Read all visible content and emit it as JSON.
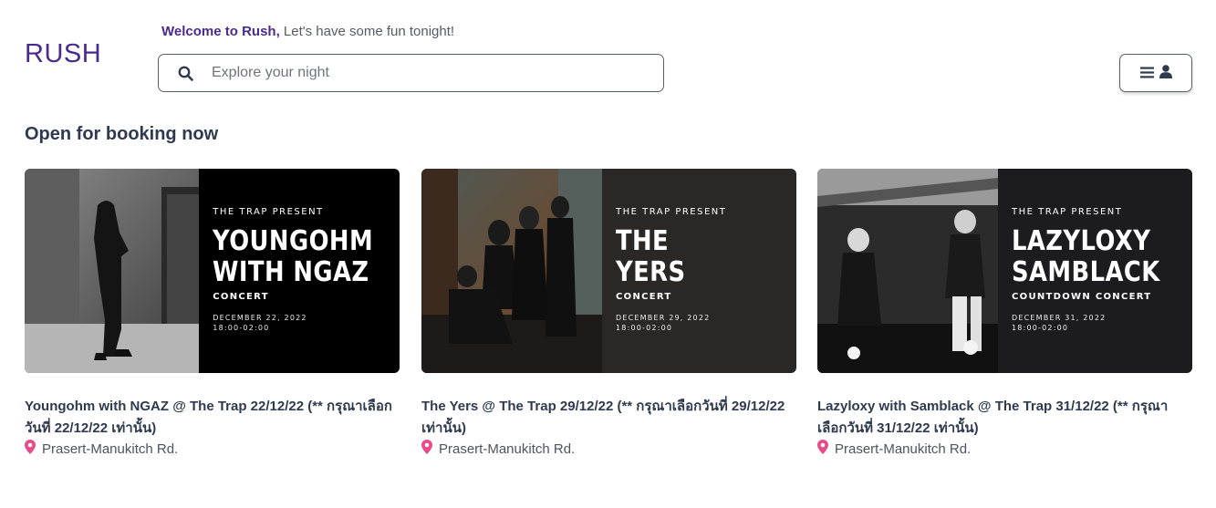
{
  "header": {
    "logo": "RUSH",
    "welcome_brand": "Welcome to Rush,",
    "welcome_text": " Let's have some fun tonight!",
    "search_placeholder": "Explore your night"
  },
  "section": {
    "title": "Open for booking now"
  },
  "events": [
    {
      "present": "THE TRAP PRESENT",
      "name_line1": "YOUNGOHM",
      "name_line2": "WITH NGAZ",
      "kind": "CONCERT",
      "date": "DECEMBER 22, 2022",
      "time": "18:00-02:00",
      "title": "Youngohm with NGAZ @ The Trap 22/12/22 (** กรุณาเลือกวันที่ 22/12/22 เท่านั้น)",
      "location": "Prasert-Manukitch Rd.",
      "panel_color": "#000000"
    },
    {
      "present": "THE TRAP PRESENT",
      "name_line1": "THE",
      "name_line2": "YERS",
      "kind": "CONCERT",
      "date": "DECEMBER 29, 2022",
      "time": "18:00-02:00",
      "title": "The Yers @ The Trap 29/12/22 (** กรุณาเลือกวันที่ 29/12/22 เท่านั้น)",
      "location": "Prasert-Manukitch Rd.",
      "panel_color": "#2a2724"
    },
    {
      "present": "THE TRAP PRESENT",
      "name_line1": "LAZYLOXY",
      "name_line2": "SAMBLACK",
      "kind": "COUNTDOWN CONCERT",
      "date": "DECEMBER 31, 2022",
      "time": "18:00-02:00",
      "title": "Lazyloxy with Samblack @ The Trap 31/12/22 (** กรุณาเลือกวันที่ 31/12/22 เท่านั้น)",
      "location": "Prasert-Manukitch Rd.",
      "panel_color": "#1c1c1e"
    }
  ],
  "colors": {
    "brand": "#4a2a8c",
    "pin": "#e84a8a",
    "text": "#2f3a4f"
  },
  "icons": {
    "search": "search-icon",
    "menu": "menu-icon",
    "user": "user-icon",
    "pin": "map-pin-icon"
  }
}
